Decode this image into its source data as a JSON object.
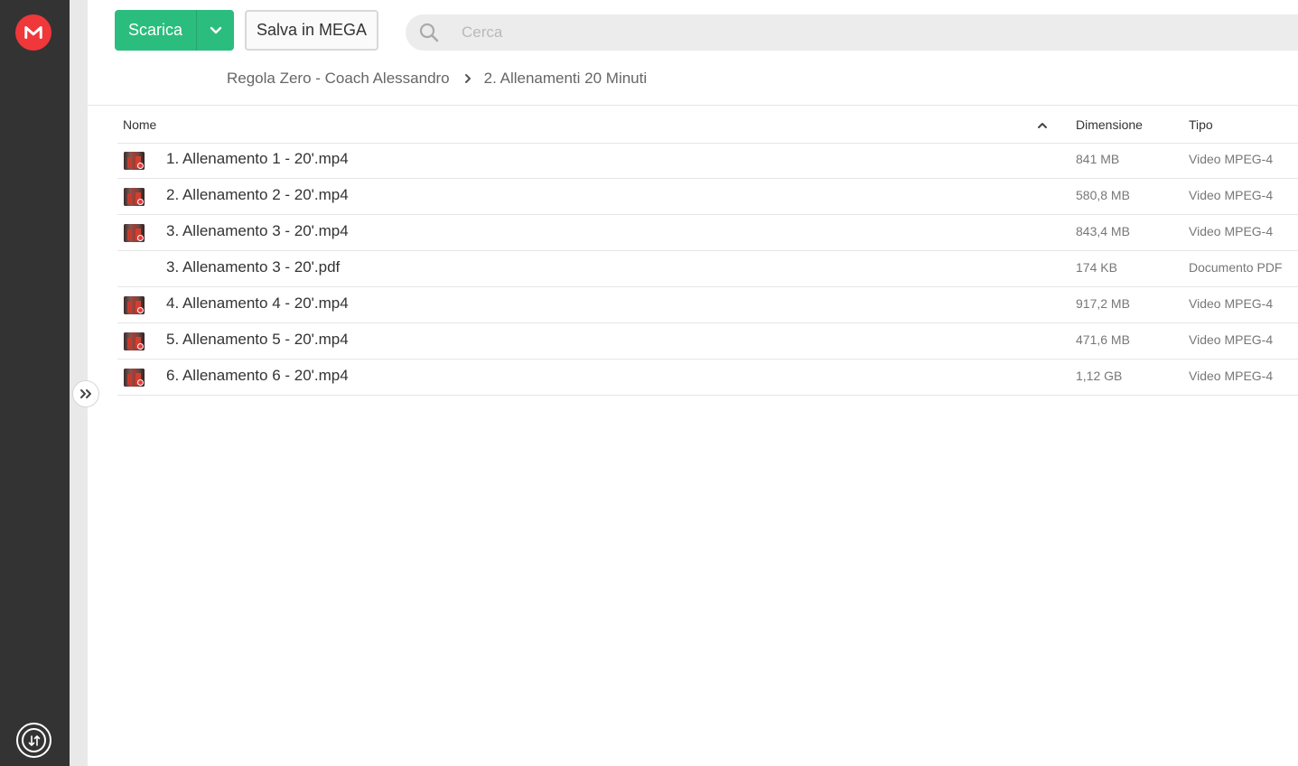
{
  "toolbar": {
    "download_label": "Scarica",
    "save_label": "Salva in MEGA"
  },
  "search": {
    "placeholder": "Cerca"
  },
  "breadcrumb": {
    "items": [
      "Regola Zero - Coach Alessandro",
      "2. Allenamenti 20 Minuti"
    ]
  },
  "table": {
    "headers": {
      "name": "Nome",
      "size": "Dimensione",
      "type": "Tipo"
    },
    "rows": [
      {
        "name": "1. Allenamento 1 - 20'.mp4",
        "size": "841 MB",
        "type": "Video MPEG-4",
        "thumb": true
      },
      {
        "name": "2. Allenamento 2 - 20'.mp4",
        "size": "580,8 MB",
        "type": "Video MPEG-4",
        "thumb": true
      },
      {
        "name": "3. Allenamento 3 - 20'.mp4",
        "size": "843,4 MB",
        "type": "Video MPEG-4",
        "thumb": true
      },
      {
        "name": "3. Allenamento 3 - 20'.pdf",
        "size": "174 KB",
        "type": "Documento PDF",
        "thumb": false
      },
      {
        "name": "4. Allenamento 4 - 20'.mp4",
        "size": "917,2 MB",
        "type": "Video MPEG-4",
        "thumb": true
      },
      {
        "name": "5. Allenamento 5 - 20'.mp4",
        "size": "471,6 MB",
        "type": "Video MPEG-4",
        "thumb": true
      },
      {
        "name": "6. Allenamento 6 - 20'.mp4",
        "size": "1,12 GB",
        "type": "Video MPEG-4",
        "thumb": true
      }
    ]
  },
  "icons": {
    "logo": "mega-logo-icon",
    "search": "search-icon",
    "caret": "chevron-down-icon",
    "breadcrumb_sep": "chevron-right-icon",
    "sort": "sort-ascending-icon",
    "expand": "double-chevron-right-icon",
    "transfers": "transfers-icon"
  },
  "colors": {
    "brand": "#f0373a",
    "primary_button": "#2bbd7d",
    "rail": "#333333"
  }
}
